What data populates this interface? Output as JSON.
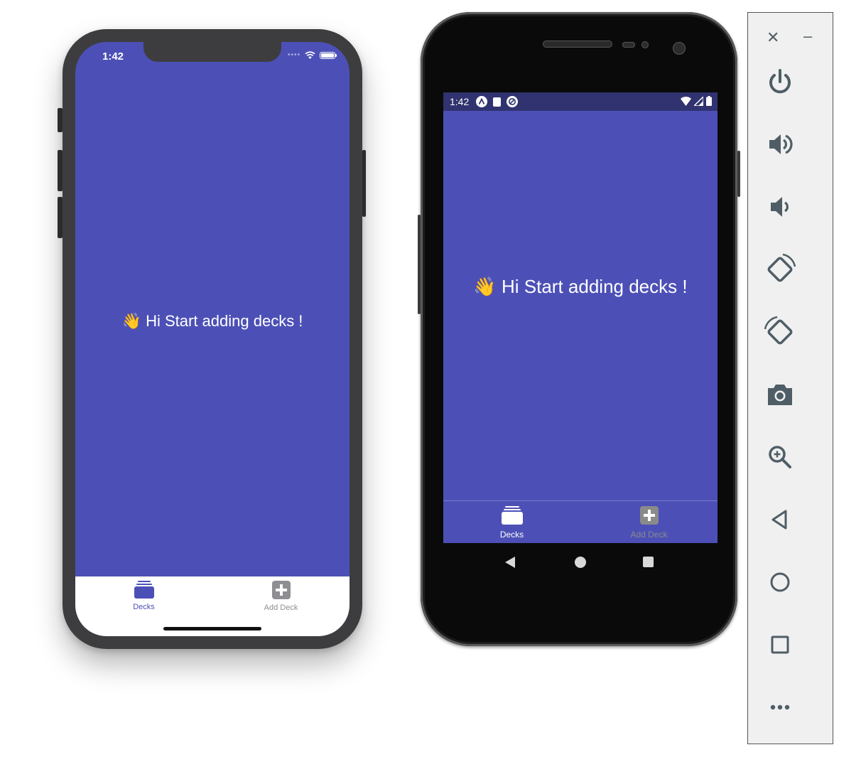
{
  "ios": {
    "time": "1:42",
    "greeting": "👋 Hi Start adding decks !",
    "tabs": [
      {
        "label": "Decks",
        "icon": "deck-icon",
        "active": true
      },
      {
        "label": "Add Deck",
        "icon": "plus-square-icon",
        "active": false
      }
    ]
  },
  "android": {
    "time": "1:42",
    "greeting": "👋 Hi Start adding decks !",
    "tabs": [
      {
        "label": "Decks",
        "icon": "deck-icon",
        "active": true
      },
      {
        "label": "Add Deck",
        "icon": "plus-square-icon",
        "active": false
      }
    ]
  },
  "toolbar": {
    "buttons": [
      "close-icon",
      "minimize-icon",
      "power-icon",
      "volume-up-icon",
      "volume-down-icon",
      "rotate-left-icon",
      "rotate-right-icon",
      "camera-icon",
      "zoom-icon",
      "back-icon",
      "home-icon",
      "overview-icon",
      "more-icon"
    ]
  },
  "colors": {
    "app_background": "#4c50b6",
    "ios_tab_active": "#4c50b6",
    "ios_tab_inactive": "#8e8e93",
    "android_tab_active": "#ffffff",
    "android_tab_inactive": "#8a8a8a",
    "toolbar_icon": "#4f5e66"
  }
}
